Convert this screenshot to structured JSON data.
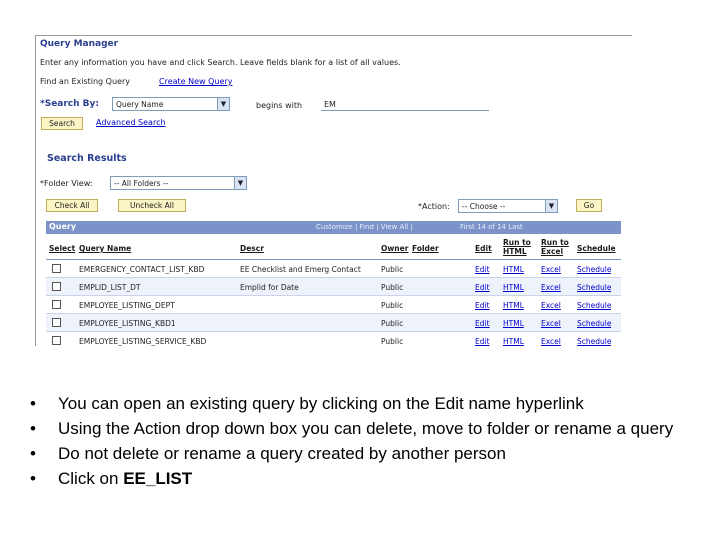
{
  "query_manager": {
    "title": "Query Manager",
    "instructions": "Enter any information you have and click Search. Leave fields blank for a list of all values.",
    "find_label": "Find an Existing Query",
    "create_link": "Create New Query",
    "search_by_label": "*Search By:",
    "search_by_value": "Query Name",
    "begins_with_label": "begins with",
    "search_value": "EM",
    "search_button": "Search",
    "advanced_search": "Advanced Search"
  },
  "results": {
    "title": "Search Results",
    "folder_view_label": "*Folder View:",
    "folder_view_value": "-- All Folders --",
    "check_all": "Check All",
    "uncheck_all": "Uncheck All",
    "action_label": "*Action:",
    "action_value": "-- Choose --",
    "go_button": "Go",
    "grid_title": "Query",
    "grid_controls": "Customize | Find | View All |",
    "grid_nav": "First  14 of 14  Last",
    "columns": {
      "select": "Select",
      "query_name": "Query Name",
      "descr": "Descr",
      "owner": "Owner",
      "folder": "Folder",
      "edit": "Edit",
      "run_html": "Run to HTML",
      "run_excel": "Run to Excel",
      "schedule": "Schedule"
    },
    "rows": [
      {
        "name": "EMERGENCY_CONTACT_LIST_KBD",
        "descr": "EE Checklist and Emerg Contact",
        "owner": "Public",
        "edit": "Edit",
        "html": "HTML",
        "excel": "Excel",
        "schedule": "Schedule"
      },
      {
        "name": "EMPLID_LIST_DT",
        "descr": "Emplid for Date",
        "owner": "Public",
        "edit": "Edit",
        "html": "HTML",
        "excel": "Excel",
        "schedule": "Schedule"
      },
      {
        "name": "EMPLOYEE_LISTING_DEPT",
        "descr": "",
        "owner": "Public",
        "edit": "Edit",
        "html": "HTML",
        "excel": "Excel",
        "schedule": "Schedule"
      },
      {
        "name": "EMPLOYEE_LISTING_KBD1",
        "descr": "",
        "owner": "Public",
        "edit": "Edit",
        "html": "HTML",
        "excel": "Excel",
        "schedule": "Schedule"
      },
      {
        "name": "EMPLOYEE_LISTING_SERVICE_KBD",
        "descr": "",
        "owner": "Public",
        "edit": "Edit",
        "html": "HTML",
        "excel": "Excel",
        "schedule": "Schedule"
      }
    ]
  },
  "bullets": [
    "You can open an existing query by clicking on the Edit name hyperlink",
    "Using the Action drop down box you can delete, move to folder or rename a query",
    "Do not delete or rename a query created by another person"
  ],
  "bullet_last_prefix": "Click on ",
  "bullet_last_bold": "EE_LIST"
}
